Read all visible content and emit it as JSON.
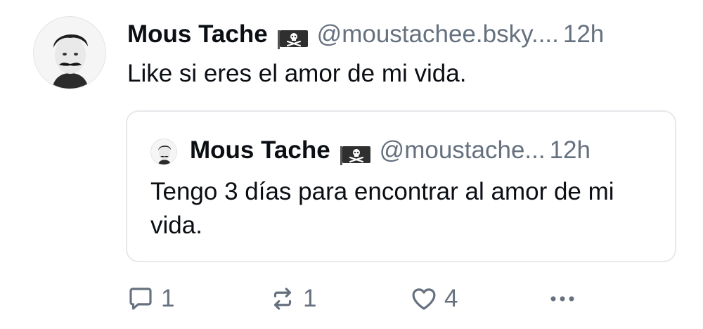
{
  "post": {
    "author": {
      "display_name": "Mous Tache",
      "handle": "@moustachee.bsky....",
      "flag_icon": "pirate-flag-icon"
    },
    "time": "12h",
    "text": "Like si eres el amor de mi vida."
  },
  "quote": {
    "author": {
      "display_name": "Mous Tache",
      "handle": "@moustache...",
      "flag_icon": "pirate-flag-icon"
    },
    "time": "12h",
    "text": "Tengo 3 días para encontrar al amor de mi vida."
  },
  "actions": {
    "reply_count": "1",
    "repost_count": "1",
    "like_count": "4",
    "reply_icon": "reply-icon",
    "repost_icon": "repost-icon",
    "like_icon": "heart-icon",
    "more_icon": "more-icon"
  },
  "colors": {
    "text": "#0b0f14",
    "muted": "#66717f",
    "border": "#e6e8eb"
  }
}
